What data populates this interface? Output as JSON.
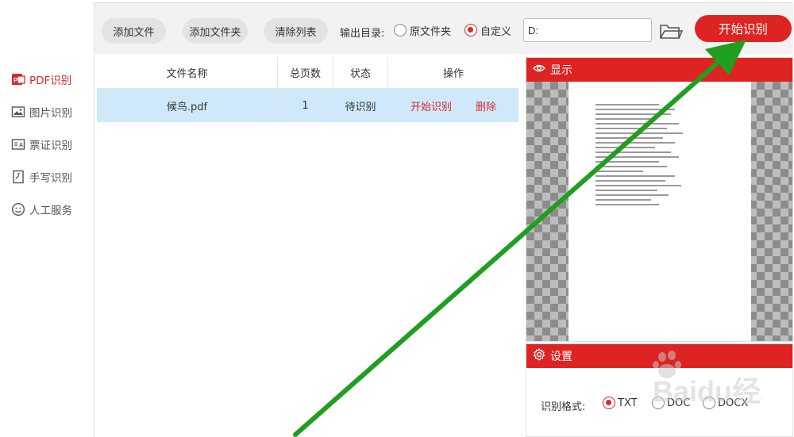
{
  "sidebar": {
    "items": [
      {
        "label": "PDF识别",
        "icon": "pdf-icon",
        "active": true
      },
      {
        "label": "图片识别",
        "icon": "image-icon",
        "active": false
      },
      {
        "label": "票证识别",
        "icon": "ticket-icon",
        "active": false
      },
      {
        "label": "手写识别",
        "icon": "handwriting-icon",
        "active": false
      },
      {
        "label": "人工服务",
        "icon": "smiley-icon",
        "active": false
      }
    ]
  },
  "toolbar": {
    "add_file": "添加文件",
    "add_folder": "添加文件夹",
    "clear_list": "清除列表",
    "output_label": "输出目录:",
    "radio_source": "原文件夹",
    "radio_custom": "自定义",
    "selected_output": "自定义",
    "path_value": "D:",
    "start_button": "开始识别"
  },
  "table": {
    "headers": [
      "文件名称",
      "总页数",
      "状态",
      "操作"
    ],
    "rows": [
      {
        "name": "候鸟.pdf",
        "pages": "1",
        "status": "待识别",
        "action_start": "开始识别",
        "action_delete": "删除"
      }
    ]
  },
  "preview": {
    "title": "显示"
  },
  "settings": {
    "title": "设置",
    "format_label": "识别格式:",
    "formats": [
      "TXT",
      "DOC",
      "DOCX"
    ],
    "selected_format": "TXT"
  },
  "watermark": {
    "text": "Baidu经验"
  },
  "colors": {
    "accent": "#de2323",
    "row_highlight": "#cfe9fb",
    "annotation_arrow": "#1f9e1f"
  }
}
